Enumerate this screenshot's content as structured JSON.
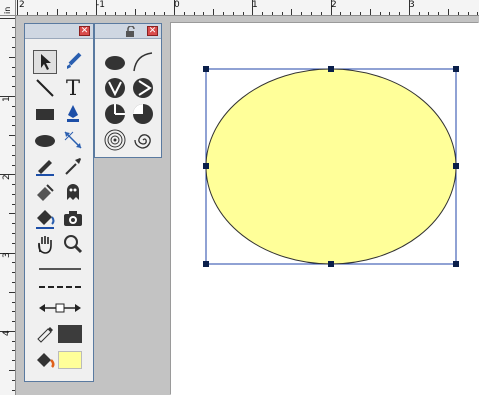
{
  "ruler": {
    "unit": "in",
    "top_labels": [
      "2",
      "-1",
      "0",
      "1",
      "2",
      "3"
    ],
    "left_labels": [
      "1",
      "2",
      "3",
      "4"
    ]
  },
  "tools_palette": {
    "close_label": "✕",
    "tools": [
      {
        "name": "selection-arrow-icon"
      },
      {
        "name": "pen-brush-icon"
      },
      {
        "name": "line-icon"
      },
      {
        "name": "text-icon",
        "label": "T"
      },
      {
        "name": "rectangle-icon"
      },
      {
        "name": "pen-nib-icon"
      },
      {
        "name": "ellipse-icon"
      },
      {
        "name": "scale-icon"
      },
      {
        "name": "pencil-icon"
      },
      {
        "name": "eyedropper-icon"
      },
      {
        "name": "eraser-icon"
      },
      {
        "name": "ghost-icon"
      },
      {
        "name": "paint-bucket-icon"
      },
      {
        "name": "camera-icon"
      },
      {
        "name": "hand-icon"
      },
      {
        "name": "magnifier-icon"
      }
    ],
    "line_styles": [
      "solid-line",
      "dashed-line",
      "arrow-line"
    ],
    "stroke_color": "#3c3c3c",
    "fill_color": "#ffff99"
  },
  "shapes_palette": {
    "close_label": "✕",
    "shapes": [
      "filled-ellipse-icon",
      "arc-icon",
      "v-circle-icon",
      "play-circle-icon",
      "pie-icon",
      "quarter-pie-icon",
      "concentric-circles-icon",
      "spiral-icon"
    ]
  },
  "canvas": {
    "shape_fill": "#ffff99",
    "shape_stroke": "#333333",
    "selection_color": "#2244aa"
  }
}
